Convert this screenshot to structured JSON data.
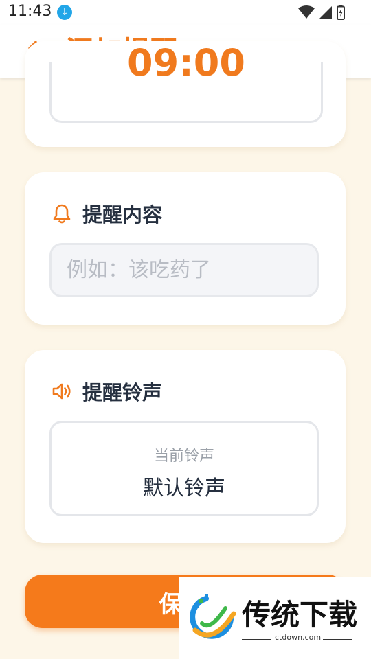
{
  "status_bar": {
    "time": "11:43",
    "download_icon": "download-icon",
    "icons": [
      "wifi-icon",
      "signal-icon",
      "battery-charging-icon"
    ]
  },
  "header": {
    "title": "添加提醒",
    "back_icon": "arrow-left-icon"
  },
  "time_card": {
    "time": "09:00"
  },
  "content_card": {
    "title": "提醒内容",
    "icon": "bell-icon",
    "input_value": "",
    "input_placeholder": "例如：该吃药了"
  },
  "ringtone_card": {
    "title": "提醒铃声",
    "icon": "speaker-icon",
    "caption": "当前铃声",
    "value": "默认铃声"
  },
  "save_button": {
    "label": "保存"
  },
  "watermark": {
    "name": "传统下载",
    "url": "ctdown.com"
  },
  "colors": {
    "accent": "#f07a1e",
    "background": "#fdf6e8",
    "text_dark": "#263040"
  }
}
